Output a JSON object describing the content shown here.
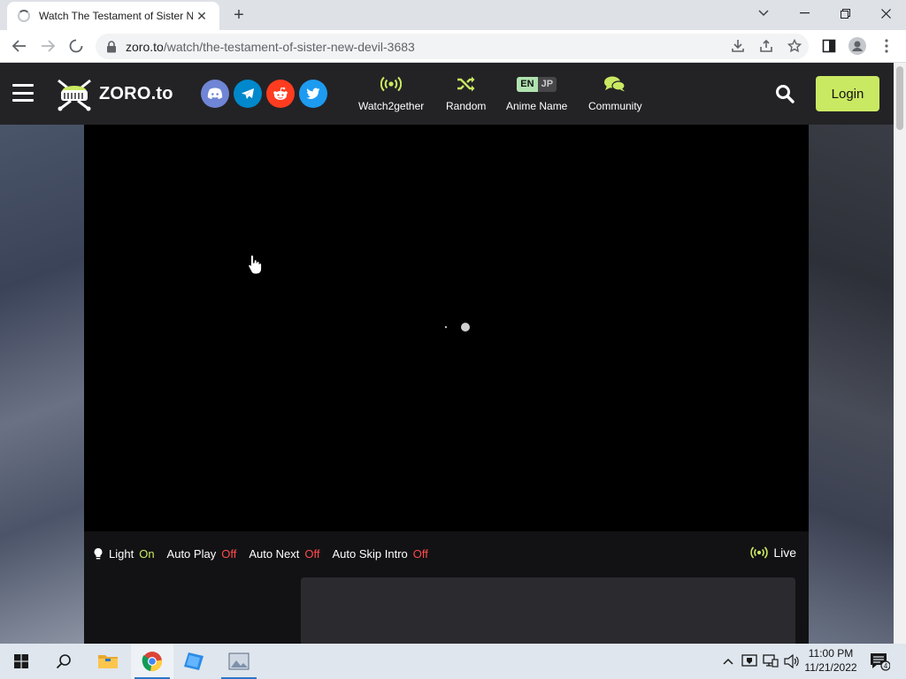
{
  "browser": {
    "tab_title": "Watch The Testament of Sister N",
    "tab_close": "✕",
    "new_tab": "+",
    "url_host": "zoro.to",
    "url_path": "/watch/the-testament-of-sister-new-devil-3683",
    "window_controls": {
      "minimize": "—",
      "maximize": "❐",
      "close": "✕",
      "tab_list": "⌄"
    }
  },
  "site": {
    "logo_text": "ZORO.to",
    "socials": [
      {
        "name": "discord",
        "color": "#6f85d5"
      },
      {
        "name": "telegram",
        "color": "#0088cc"
      },
      {
        "name": "reddit",
        "color": "#ff3c1f"
      },
      {
        "name": "twitter",
        "color": "#1d9bf0"
      }
    ],
    "nav": {
      "watch2gether": "Watch2gether",
      "random": "Random",
      "anime_name": "Anime Name",
      "lang_en": "EN",
      "lang_jp": "JP",
      "community": "Community"
    },
    "login": "Login",
    "accent_color": "#cae962"
  },
  "player_controls": {
    "light_label": "Light",
    "light_value": "On",
    "autoplay_label": "Auto Play",
    "autoplay_value": "Off",
    "autonext_label": "Auto Next",
    "autonext_value": "Off",
    "autoskip_label": "Auto Skip Intro",
    "autoskip_value": "Off",
    "live_label": "Live"
  },
  "taskbar": {
    "time": "11:00 PM",
    "date": "11/21/2022",
    "notification_count": "4"
  }
}
